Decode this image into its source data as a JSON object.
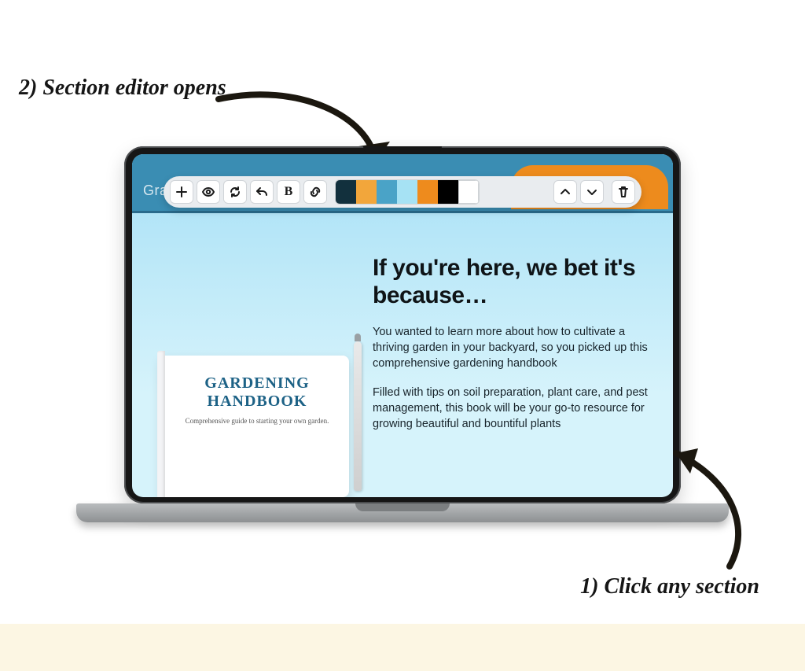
{
  "annotations": {
    "step2": "2) Section editor opens",
    "step1": "1) Click any section"
  },
  "topbar": {
    "brand_clip": "Gra"
  },
  "toolbar": {
    "icons": {
      "add": "plus-icon",
      "preview": "eye-icon",
      "refresh": "refresh-icon",
      "undo": "undo-icon",
      "bold": "B",
      "link": "link-icon",
      "move_up": "chevron-up-icon",
      "move_down": "chevron-down-icon",
      "delete": "trash-icon"
    },
    "palette": [
      "#12303d",
      "#f2a63b",
      "#4aa3c7",
      "#a6e2f4",
      "#ee8b1d",
      "#000000",
      "#ffffff"
    ]
  },
  "hero": {
    "heading": "If you're here, we bet it's because…",
    "p1": "You wanted to learn more about how to cultivate a thriving garden in your backyard, so you picked up this comprehensive gardening handbook",
    "p2": "Filled with tips on soil preparation, plant care, and pest management, this book will be your go-to resource for growing beautiful and bountiful plants"
  },
  "book": {
    "title": "GARDENING HANDBOOK",
    "subtitle": "Comprehensive guide to starting your own garden."
  }
}
